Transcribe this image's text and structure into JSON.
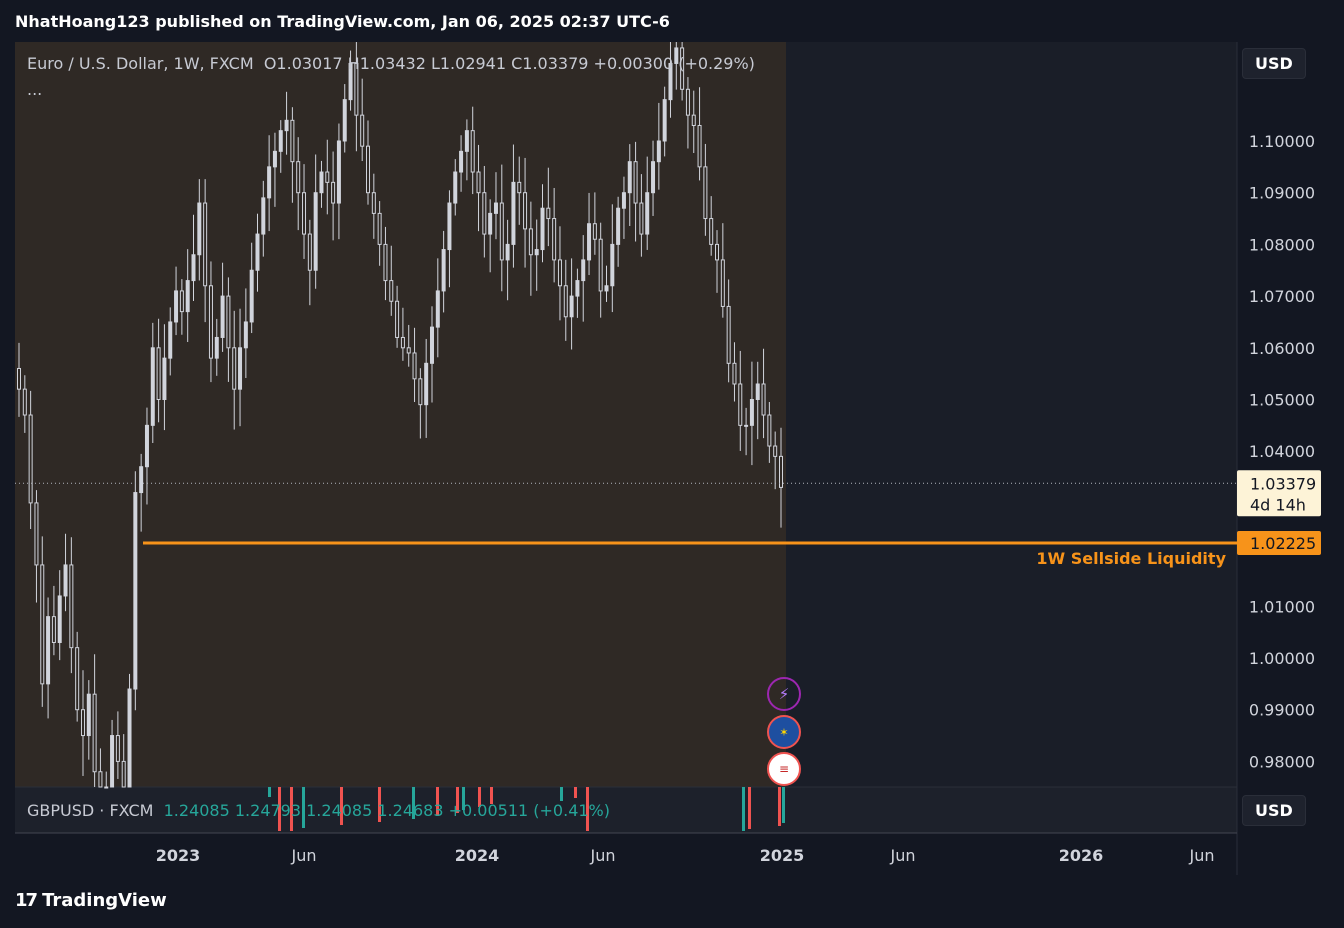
{
  "header": {
    "published": "NhatHoang123 published on TradingView.com, Jan 06, 2025 02:37 UTC-6"
  },
  "legend": {
    "symbol": "Euro / U.S. Dollar, 1W, FXCM",
    "ohlc": "O1.03017  H1.03432  L1.02941  C1.03379  +0.00300 (+0.29%)",
    "more": "..."
  },
  "sub_legend": {
    "symbol": "GBPUSD · FXCM",
    "values": "1.24085  1.24793  1.24085  1.24683  +0.00511 (+0.41%)"
  },
  "currency_label": "USD",
  "brand": {
    "logo": "17",
    "name": "TradingView"
  },
  "colors": {
    "background": "#131722",
    "history_shade": "#2f2925",
    "candle": "#d1d4dc",
    "level": "#f7931a",
    "price_tag_bg": "#fdf3d7",
    "up": "#26a69a",
    "down": "#ef5350"
  },
  "icons": [
    "lightning-event-icon",
    "eu-flag-icon",
    "us-flag-icon"
  ],
  "chart_data": {
    "type": "candlestick",
    "y_axis": {
      "ticks": [
        "1.10000",
        "1.09000",
        "1.08000",
        "1.07000",
        "1.06000",
        "1.05000",
        "1.04000",
        "1.01000",
        "1.00000",
        "0.99000",
        "0.98000"
      ],
      "range": [
        0.975,
        1.115
      ]
    },
    "x_axis": {
      "ticks": [
        "2023",
        "Jun",
        "2024",
        "Jun",
        "2025",
        "Jun",
        "2026",
        "Jun"
      ]
    },
    "last_price": {
      "value": 1.03379,
      "label": "1.03379",
      "countdown": "4d 14h"
    },
    "levels": [
      {
        "value": 1.02225,
        "label": "1.02225",
        "annotation": "1W Sellside Liquidity"
      }
    ],
    "closes": [
      1.052,
      1.047,
      1.03,
      1.018,
      0.995,
      1.008,
      1.003,
      1.012,
      1.018,
      1.002,
      0.99,
      0.985,
      0.993,
      0.978,
      0.972,
      0.968,
      0.985,
      0.98,
      0.972,
      0.994,
      1.032,
      1.037,
      1.045,
      1.06,
      1.05,
      1.058,
      1.065,
      1.071,
      1.067,
      1.073,
      1.078,
      1.088,
      1.072,
      1.058,
      1.062,
      1.07,
      1.06,
      1.052,
      1.06,
      1.065,
      1.075,
      1.082,
      1.089,
      1.095,
      1.098,
      1.102,
      1.104,
      1.096,
      1.09,
      1.082,
      1.075,
      1.09,
      1.094,
      1.092,
      1.088,
      1.1,
      1.108,
      1.115,
      1.105,
      1.099,
      1.09,
      1.086,
      1.08,
      1.073,
      1.069,
      1.062,
      1.06,
      1.059,
      1.054,
      1.049,
      1.057,
      1.064,
      1.071,
      1.079,
      1.088,
      1.094,
      1.098,
      1.102,
      1.094,
      1.09,
      1.082,
      1.086,
      1.088,
      1.077,
      1.08,
      1.092,
      1.09,
      1.083,
      1.078,
      1.079,
      1.087,
      1.085,
      1.077,
      1.072,
      1.066,
      1.07,
      1.073,
      1.077,
      1.084,
      1.081,
      1.071,
      1.072,
      1.08,
      1.087,
      1.09,
      1.096,
      1.088,
      1.082,
      1.09,
      1.096,
      1.1,
      1.108,
      1.115,
      1.118,
      1.11,
      1.105,
      1.103,
      1.095,
      1.085,
      1.08,
      1.077,
      1.068,
      1.057,
      1.053,
      1.045,
      1.045,
      1.05,
      1.053,
      1.047,
      1.041,
      1.039,
      1.033
    ]
  }
}
